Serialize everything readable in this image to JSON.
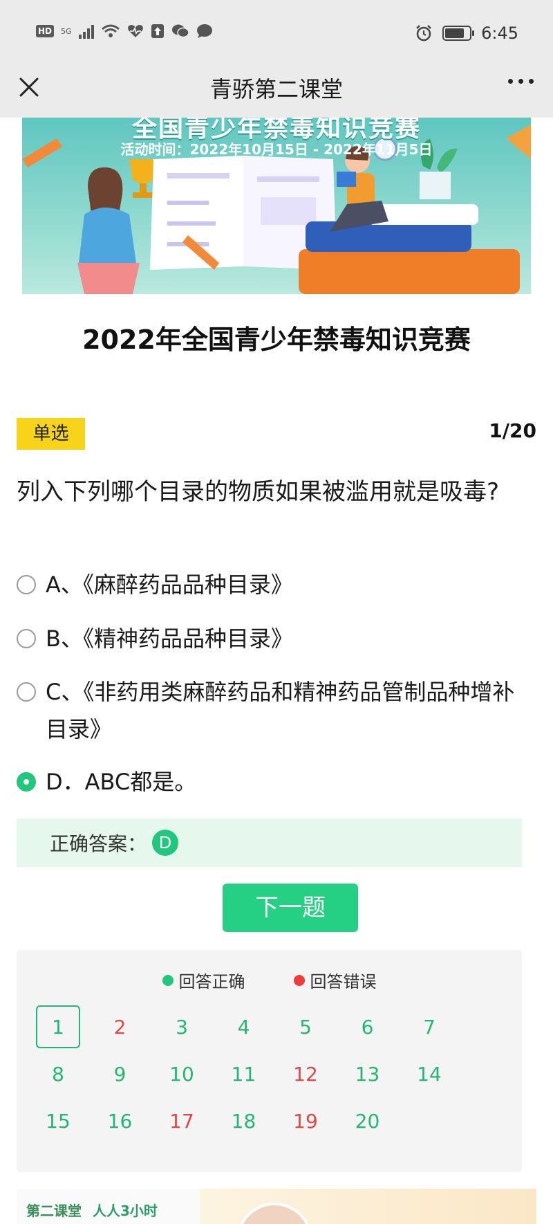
{
  "status_bar": {
    "hd": "HD",
    "network": "5G",
    "time": "6:45"
  },
  "nav": {
    "title": "青骄第二课堂",
    "close_icon": "close-icon",
    "more_icon": "more-horizontal-icon"
  },
  "banner": {
    "headline": "全国青少年禁毒知识竞赛",
    "dates": "活动时间：2022年10月15日 - 2022年11月5日"
  },
  "contest_title": "2022年全国青少年禁毒知识竞赛",
  "question": {
    "type_label": "单选",
    "counter": "1/20",
    "text": "列入下列哪个目录的物质如果被滥用就是吸毒?",
    "options": [
      {
        "label": "A、《麻醉药品品种目录》",
        "selected": false
      },
      {
        "label": "B、《精神药品品种目录》",
        "selected": false
      },
      {
        "label": "C、《非药用类麻醉药品和精神药品管制品种增补目录》",
        "selected": false
      },
      {
        "label": "D．ABC都是。",
        "selected": true
      }
    ]
  },
  "answer": {
    "label": "正确答案：",
    "value": "D"
  },
  "next_button": "下一题",
  "sheet": {
    "legend_correct": "回答正确",
    "legend_wrong": "回答错误",
    "colors": {
      "correct": "#22b773",
      "wrong": "#e24747"
    },
    "questions": [
      {
        "n": "1",
        "status": "correct",
        "current": true
      },
      {
        "n": "2",
        "status": "wrong"
      },
      {
        "n": "3",
        "status": "correct"
      },
      {
        "n": "4",
        "status": "correct"
      },
      {
        "n": "5",
        "status": "correct"
      },
      {
        "n": "6",
        "status": "correct"
      },
      {
        "n": "7",
        "status": "correct"
      },
      {
        "n": "8",
        "status": "correct"
      },
      {
        "n": "9",
        "status": "correct"
      },
      {
        "n": "10",
        "status": "correct"
      },
      {
        "n": "11",
        "status": "correct"
      },
      {
        "n": "12",
        "status": "wrong"
      },
      {
        "n": "13",
        "status": "correct"
      },
      {
        "n": "14",
        "status": "correct"
      },
      {
        "n": "15",
        "status": "correct"
      },
      {
        "n": "16",
        "status": "correct"
      },
      {
        "n": "17",
        "status": "wrong"
      },
      {
        "n": "18",
        "status": "correct"
      },
      {
        "n": "19",
        "status": "wrong"
      },
      {
        "n": "20",
        "status": "correct"
      }
    ]
  },
  "ad": {
    "brand_1": "第二课堂",
    "brand_2": "人人3小时"
  }
}
